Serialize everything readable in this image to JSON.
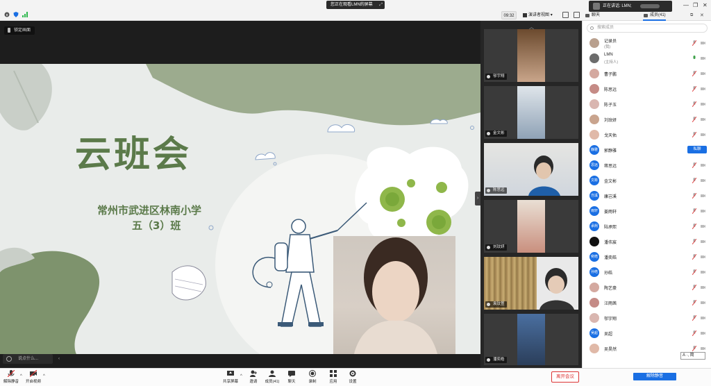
{
  "topbar": {
    "sharing_banner": "您正在观看LMN的屏幕",
    "time": "09:32",
    "view_mode": "演讲者视图",
    "speaker_label": "正在讲话: LMN;",
    "tab_chat": "聊天",
    "tab_members": "成员(41)"
  },
  "share": {
    "lock_label": "锁定画面",
    "chat_placeholder": "说点什么..."
  },
  "slide": {
    "title": "云班会",
    "school": "常州市武进区林南小学",
    "class_name": "五（3）班",
    "accent_color": "#5b7a4a"
  },
  "gallery": {
    "tiles": [
      {
        "name": "邬宇翔"
      },
      {
        "name": "金文彬"
      },
      {
        "name": "陈思远"
      },
      {
        "name": "刘玟妍"
      },
      {
        "name": "袁玟萱"
      },
      {
        "name": "潘奕皓"
      }
    ]
  },
  "participants": {
    "search_placeholder": "搜索成员",
    "private_chat_label": "私聊",
    "items": [
      {
        "name": "记录员",
        "sub": "(我)",
        "avatar": ""
      },
      {
        "name": "LMN",
        "sub": "(主持人)",
        "avatar": ""
      },
      {
        "name": "曹子鹏",
        "sub": "",
        "avatar": ""
      },
      {
        "name": "陈思远",
        "sub": "",
        "avatar": ""
      },
      {
        "name": "陈子玉",
        "sub": "",
        "avatar": ""
      },
      {
        "name": "刘玟妍",
        "sub": "",
        "avatar": ""
      },
      {
        "name": "戈天佑",
        "sub": "",
        "avatar": ""
      },
      {
        "name": "郭静雅",
        "sub": "",
        "avatar": "静雅"
      },
      {
        "name": "蒋思远",
        "sub": "",
        "avatar": "思远"
      },
      {
        "name": "金文彬",
        "sub": "",
        "avatar": "文彬"
      },
      {
        "name": "康岂溪",
        "sub": "",
        "avatar": "岂溪"
      },
      {
        "name": "姜雨轩",
        "sub": "",
        "avatar": "雨轩"
      },
      {
        "name": "陆承熙",
        "sub": "",
        "avatar": "承熙"
      },
      {
        "name": "潘伟宸",
        "sub": "",
        "avatar": ""
      },
      {
        "name": "潘奕皓",
        "sub": "",
        "avatar": "奕皓"
      },
      {
        "name": "孙皓",
        "sub": "",
        "avatar": "孙皓"
      },
      {
        "name": "陶艺豪",
        "sub": "",
        "avatar": ""
      },
      {
        "name": "汪雨茜",
        "sub": "",
        "avatar": ""
      },
      {
        "name": "邬宇翔",
        "sub": "",
        "avatar": ""
      },
      {
        "name": "吴超",
        "sub": "",
        "avatar": "吴超"
      },
      {
        "name": "吴昊然",
        "sub": "",
        "avatar": ""
      }
    ]
  },
  "ime": "A ·, 简",
  "toolbar": {
    "unmute": "解除静音",
    "start_video": "开启视频",
    "share_screen": "共享屏幕",
    "invite": "邀请",
    "members": "成员(41)",
    "chat": "聊天",
    "record": "录制",
    "apps": "应用",
    "settings": "设置",
    "leave": "离开会议",
    "unmute_all": "解除静音"
  }
}
